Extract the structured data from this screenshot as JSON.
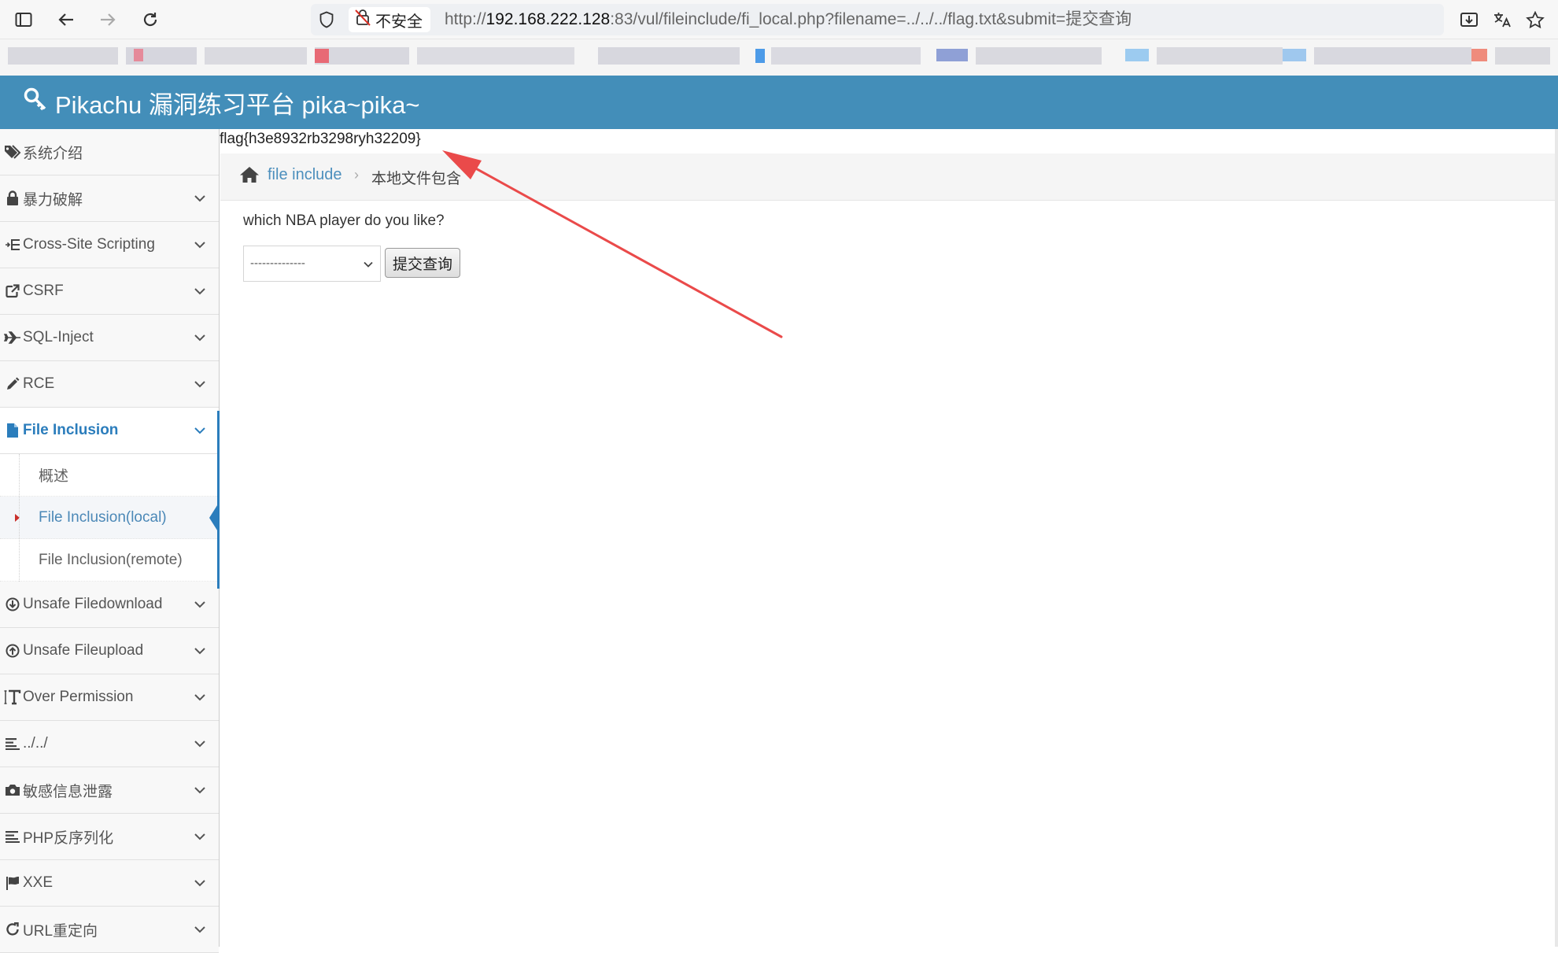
{
  "browser": {
    "insecure_label": "不安全",
    "url_scheme": "http://",
    "url_host": "192.168.222.128",
    "url_rest": ":83/vul/fileinclude/fi_local.php?filename=../../../flag.txt&submit=提交查询"
  },
  "header": {
    "brand": "Pikachu 漏洞练习平台 pika~pika~"
  },
  "sidebar": {
    "items": [
      {
        "label": "系统介绍",
        "icon": "tags-icon",
        "has_submenu": false
      },
      {
        "label": "暴力破解",
        "icon": "lock-icon",
        "has_submenu": true
      },
      {
        "label": "Cross-Site Scripting",
        "icon": "list-indent-icon",
        "has_submenu": true
      },
      {
        "label": "CSRF",
        "icon": "external-link-icon",
        "has_submenu": true
      },
      {
        "label": "SQL-Inject",
        "icon": "plane-icon",
        "has_submenu": true
      },
      {
        "label": "RCE",
        "icon": "pencil-icon",
        "has_submenu": true
      },
      {
        "label": "File Inclusion",
        "icon": "file-icon",
        "has_submenu": true,
        "active": true
      },
      {
        "label": "Unsafe Filedownload",
        "icon": "download-circle-icon",
        "has_submenu": true
      },
      {
        "label": "Unsafe Fileupload",
        "icon": "upload-circle-icon",
        "has_submenu": true
      },
      {
        "label": "Over Permission",
        "icon": "text-height-icon",
        "has_submenu": true
      },
      {
        "label": "../../",
        "icon": "align-left-icon",
        "has_submenu": true
      },
      {
        "label": "敏感信息泄露",
        "icon": "camera-icon",
        "has_submenu": true
      },
      {
        "label": "PHP反序列化",
        "icon": "align-left-icon",
        "has_submenu": true
      },
      {
        "label": "XXE",
        "icon": "flag-icon",
        "has_submenu": true
      },
      {
        "label": "URL重定向",
        "icon": "refresh-icon",
        "has_submenu": true
      }
    ],
    "submenu": [
      {
        "label": "概述"
      },
      {
        "label": "File Inclusion(local)",
        "current": true
      },
      {
        "label": "File Inclusion(remote)"
      }
    ]
  },
  "content": {
    "flag_output": "flag{h3e8932rb3298ryh32209}",
    "breadcrumb": {
      "parent": "file include",
      "current": "本地文件包含"
    },
    "question": "which NBA player do you like?",
    "select_value": "--------------",
    "submit_label": "提交查询"
  },
  "colors": {
    "navbar": "#438eb9",
    "active_link": "#2b7dbc",
    "annotation_arrow": "#ea4a4a"
  }
}
